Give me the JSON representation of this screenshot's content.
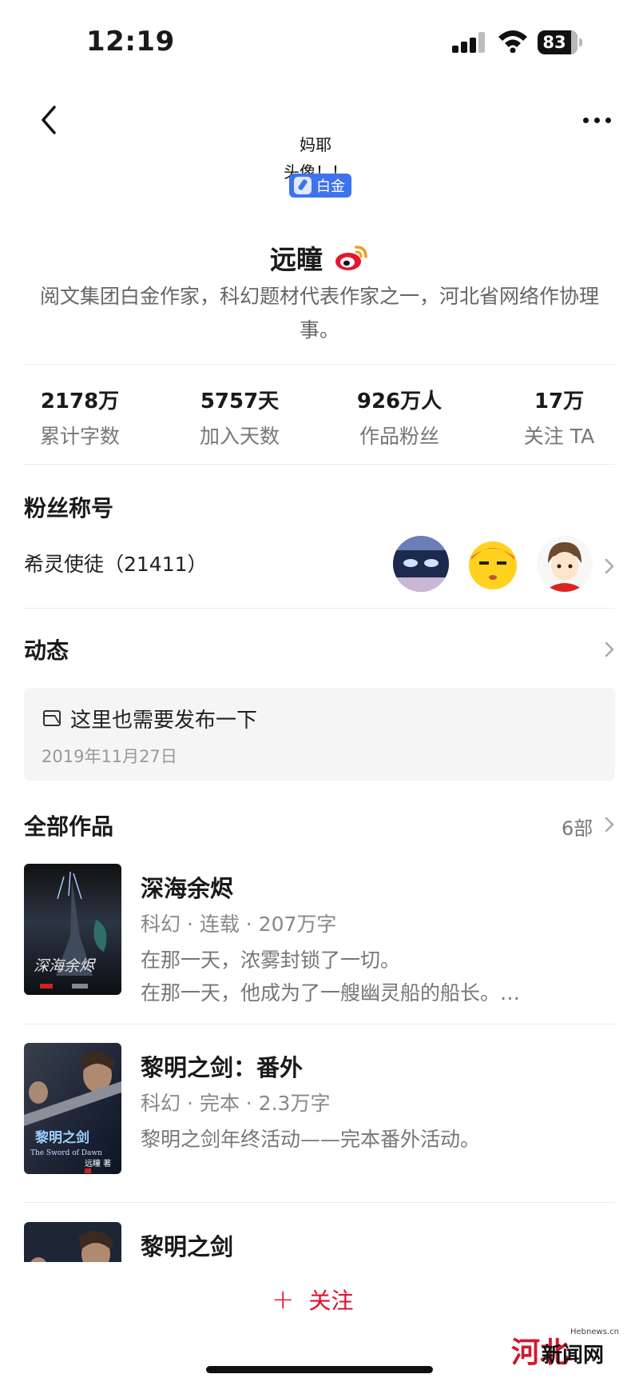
{
  "status_bar": {
    "time": "12:19",
    "battery": "83",
    "icons": [
      "signal-icon",
      "wifi-icon",
      "battery-icon"
    ]
  },
  "nav": {
    "back_icon": "chevron-left-icon",
    "more_icon": "more-horizontal-icon"
  },
  "profile": {
    "avatar_text_line1": "妈耶",
    "avatar_text_line2": "头像！！",
    "badge": "白金",
    "name": "远瞳",
    "verified_icon": "weibo-icon",
    "intro": "阅文集团白金作家，科幻题材代表作家之一，河北省网络作协理事。"
  },
  "stats": [
    {
      "value": "2178万",
      "label": "累计字数"
    },
    {
      "value": "5757天",
      "label": "加入天数"
    },
    {
      "value": "926万人",
      "label": "作品粉丝"
    },
    {
      "value": "17万",
      "label": "关注 TA"
    }
  ],
  "fans": {
    "title": "粉丝称号",
    "name": "希灵使徒（21411）",
    "avatars": [
      "fan-avatar-1",
      "fan-avatar-2",
      "fan-avatar-3"
    ]
  },
  "feed": {
    "title": "动态",
    "post_text": "这里也需要发布一下",
    "post_date": "2019年11月27日"
  },
  "works": {
    "title": "全部作品",
    "count": "6部",
    "books": [
      {
        "title": "深海余烬",
        "meta": "科幻 · 连载 · 207万字",
        "desc1": "在那一天，浓雾封锁了一切。",
        "desc2": "在那一天，他成为了一艘幽灵船的船长。…",
        "cover_title": "深海余烬"
      },
      {
        "title": "黎明之剑：番外",
        "meta": "科幻 · 完本 · 2.3万字",
        "desc1": "黎明之剑年终活动——完本番外活动。",
        "desc2": "",
        "cover_title": "黎明之剑",
        "cover_sub": "The Sword of Dawn",
        "cover_author": "远瞳 著"
      },
      {
        "title": "黎明之剑",
        "meta": "",
        "desc1": "",
        "desc2": ""
      }
    ]
  },
  "bottom": {
    "follow_plus": "+",
    "follow_label": "关注",
    "watermark_main": "新闻网",
    "watermark_sub": "Hebnews.cn",
    "watermark_mark": "河北"
  },
  "colors": {
    "accent": "#e0102b",
    "badge": "#3d72f0",
    "card_bg": "#f5f5f5"
  }
}
